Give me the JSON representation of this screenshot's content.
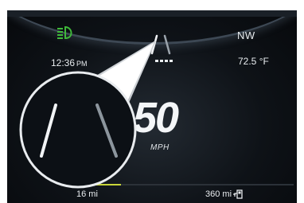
{
  "cluster": {
    "compass_heading": "NW",
    "time": "12:36",
    "time_period": "PM",
    "outside_temp": "72.5 °F",
    "speed": "50",
    "speed_unit": "MPH",
    "trip_distance": "16 mi",
    "fuel_range": "360 mi",
    "fuel_range_fraction": 0.18
  },
  "icons": {
    "headlamp": "headlamp-indicator-icon",
    "lane": "lane-sense-icon",
    "fuel": "fuel-pump-icon",
    "page_dots": "page-indicator-dots"
  },
  "colors": {
    "headlamp_indicator": "#3fb83a",
    "progress_fill": "#c9d63a",
    "background": "#0e1217"
  }
}
